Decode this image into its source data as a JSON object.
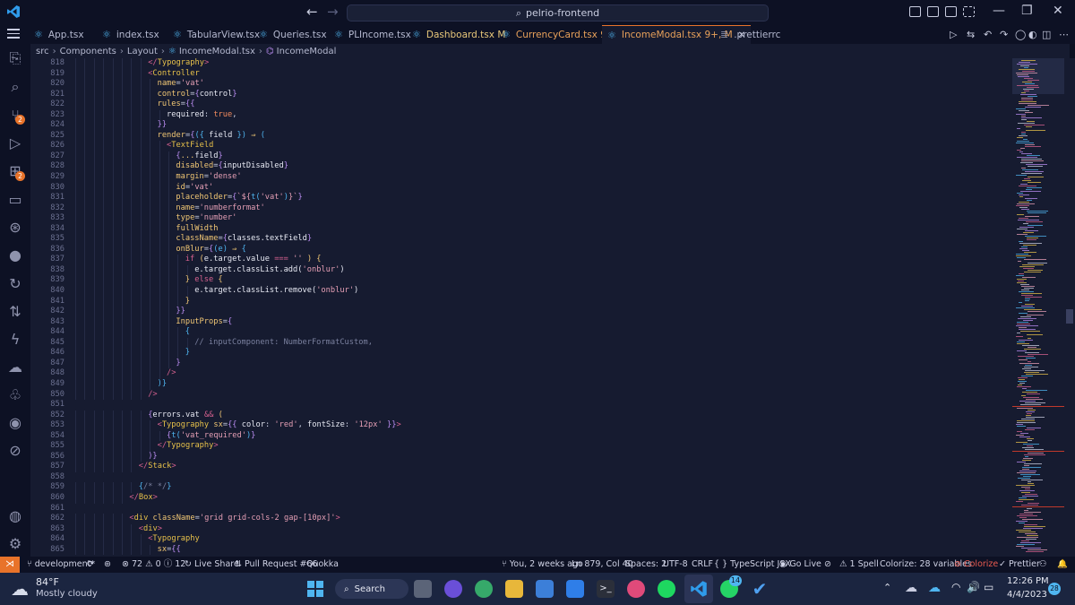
{
  "window": {
    "search_text": "pelrio-frontend"
  },
  "tabs": [
    {
      "label": "App.tsx",
      "color": "#b4b8cf"
    },
    {
      "label": "index.tsx",
      "color": "#b4b8cf"
    },
    {
      "label": "TabularView.tsx",
      "color": "#b4b8cf"
    },
    {
      "label": "Queries.tsx",
      "color": "#b4b8cf"
    },
    {
      "label": "PLIncome.tsx",
      "color": "#b4b8cf"
    },
    {
      "label": "Dashboard.tsx M",
      "color": "#e8c77a"
    },
    {
      "label": "CurrencyCard.tsx 9+",
      "color": "#e8a15a"
    },
    {
      "label": "IncomeModal.tsx 9+, M",
      "color": "#e8a15a"
    },
    {
      "label": ".prettierrc",
      "color": "#b4b8cf"
    }
  ],
  "breadcrumb": [
    "src",
    "Components",
    "Layout",
    "IncomeModal.tsx",
    "IncomeModal"
  ],
  "editor": {
    "lines": [
      {
        "n": "818",
        "i": 8,
        "t": [
          [
            "</",
            "#d6618f"
          ],
          [
            "Typography",
            "#e6c04a"
          ],
          [
            ">",
            "#d6618f"
          ]
        ]
      },
      {
        "n": "819",
        "i": 8,
        "t": [
          [
            "<",
            "#d6618f"
          ],
          [
            "Controller",
            "#e6c04a"
          ]
        ]
      },
      {
        "n": "820",
        "i": 9,
        "t": [
          [
            "name",
            "#f0c674"
          ],
          [
            "=",
            "#c9cde0"
          ],
          [
            "'vat'",
            "#e59fb5"
          ]
        ]
      },
      {
        "n": "821",
        "i": 9,
        "t": [
          [
            "control",
            "#f0c674"
          ],
          [
            "=",
            "#c9cde0"
          ],
          [
            "{",
            "#b98cf0"
          ],
          [
            "control",
            "#e6e8f2"
          ],
          [
            "}",
            "#b98cf0"
          ]
        ]
      },
      {
        "n": "822",
        "i": 9,
        "t": [
          [
            "rules",
            "#f0c674"
          ],
          [
            "=",
            "#c9cde0"
          ],
          [
            "{{",
            "#b98cf0"
          ]
        ]
      },
      {
        "n": "823",
        "i": 10,
        "t": [
          [
            "required",
            "#e6e8f2"
          ],
          [
            ": ",
            "#c9cde0"
          ],
          [
            "true",
            "#f08a5d"
          ],
          [
            ",",
            "#c9cde0"
          ]
        ]
      },
      {
        "n": "824",
        "i": 9,
        "t": [
          [
            "}}",
            "#b98cf0"
          ]
        ]
      },
      {
        "n": "825",
        "i": 9,
        "t": [
          [
            "render",
            "#f0c674"
          ],
          [
            "=",
            "#c9cde0"
          ],
          [
            "{",
            "#b98cf0"
          ],
          [
            "({ ",
            "#4fb5f0"
          ],
          [
            "field",
            "#e6e8f2"
          ],
          [
            " }) ",
            "#4fb5f0"
          ],
          [
            "⇒",
            "#f0c674"
          ],
          [
            " (",
            "#4fb5f0"
          ]
        ]
      },
      {
        "n": "826",
        "i": 10,
        "t": [
          [
            "<",
            "#d6618f"
          ],
          [
            "TextField",
            "#e6c04a"
          ]
        ]
      },
      {
        "n": "827",
        "i": 11,
        "t": [
          [
            "{",
            "#b98cf0"
          ],
          [
            "...",
            "#f0c674"
          ],
          [
            "field",
            "#e6e8f2"
          ],
          [
            "}",
            "#b98cf0"
          ]
        ]
      },
      {
        "n": "828",
        "i": 11,
        "t": [
          [
            "disabled",
            "#f0c674"
          ],
          [
            "=",
            "#c9cde0"
          ],
          [
            "{",
            "#b98cf0"
          ],
          [
            "inputDisabled",
            "#e6e8f2"
          ],
          [
            "}",
            "#b98cf0"
          ]
        ]
      },
      {
        "n": "829",
        "i": 11,
        "t": [
          [
            "margin",
            "#f0c674"
          ],
          [
            "=",
            "#c9cde0"
          ],
          [
            "'dense'",
            "#e59fb5"
          ]
        ]
      },
      {
        "n": "830",
        "i": 11,
        "t": [
          [
            "id",
            "#f0c674"
          ],
          [
            "=",
            "#c9cde0"
          ],
          [
            "'vat'",
            "#e59fb5"
          ]
        ]
      },
      {
        "n": "831",
        "i": 11,
        "t": [
          [
            "placeholder",
            "#f0c674"
          ],
          [
            "=",
            "#c9cde0"
          ],
          [
            "{",
            "#b98cf0"
          ],
          [
            "`${",
            "#e59fb5"
          ],
          [
            "t(",
            "#4fb5f0"
          ],
          [
            "'vat'",
            "#e59fb5"
          ],
          [
            ")",
            "#4fb5f0"
          ],
          [
            "}`",
            "#e59fb5"
          ],
          [
            "}",
            "#b98cf0"
          ]
        ]
      },
      {
        "n": "832",
        "i": 11,
        "t": [
          [
            "name",
            "#f0c674"
          ],
          [
            "=",
            "#c9cde0"
          ],
          [
            "'numberformat'",
            "#e59fb5"
          ]
        ]
      },
      {
        "n": "833",
        "i": 11,
        "t": [
          [
            "type",
            "#f0c674"
          ],
          [
            "=",
            "#c9cde0"
          ],
          [
            "'number'",
            "#e59fb5"
          ]
        ]
      },
      {
        "n": "834",
        "i": 11,
        "t": [
          [
            "fullWidth",
            "#f0c674"
          ]
        ]
      },
      {
        "n": "835",
        "i": 11,
        "t": [
          [
            "className",
            "#f0c674"
          ],
          [
            "=",
            "#c9cde0"
          ],
          [
            "{",
            "#b98cf0"
          ],
          [
            "classes",
            "#e6e8f2"
          ],
          [
            ".textField",
            "#e6e8f2"
          ],
          [
            "}",
            "#b98cf0"
          ]
        ]
      },
      {
        "n": "836",
        "i": 11,
        "t": [
          [
            "onBlur",
            "#f0c674"
          ],
          [
            "=",
            "#c9cde0"
          ],
          [
            "{",
            "#b98cf0"
          ],
          [
            "(e) ",
            "#4fb5f0"
          ],
          [
            "⇒",
            "#f0c674"
          ],
          [
            " {",
            "#4fb5f0"
          ]
        ]
      },
      {
        "n": "837",
        "i": 12,
        "t": [
          [
            "if ",
            "#d6618f"
          ],
          [
            "(",
            "#f0c674"
          ],
          [
            "e.target.value ",
            "#e6e8f2"
          ],
          [
            "===",
            "#d6618f"
          ],
          [
            " '' ",
            "#e59fb5"
          ],
          [
            ") {",
            "#f0c674"
          ]
        ]
      },
      {
        "n": "838",
        "i": 13,
        "t": [
          [
            "e.target.classList.add(",
            "#e6e8f2"
          ],
          [
            "'onblur'",
            "#e59fb5"
          ],
          [
            ")",
            "#e6e8f2"
          ]
        ]
      },
      {
        "n": "839",
        "i": 12,
        "t": [
          [
            "} ",
            "#f0c674"
          ],
          [
            "else",
            "#d6618f"
          ],
          [
            " {",
            "#f0c674"
          ]
        ]
      },
      {
        "n": "840",
        "i": 13,
        "t": [
          [
            "e.target.classList.remove(",
            "#e6e8f2"
          ],
          [
            "'onblur'",
            "#e59fb5"
          ],
          [
            ")",
            "#e6e8f2"
          ]
        ]
      },
      {
        "n": "841",
        "i": 12,
        "t": [
          [
            "}",
            "#f0c674"
          ]
        ]
      },
      {
        "n": "842",
        "i": 11,
        "t": [
          [
            "}}",
            "#b98cf0"
          ]
        ]
      },
      {
        "n": "843",
        "i": 11,
        "t": [
          [
            "InputProps",
            "#f0c674"
          ],
          [
            "=",
            "#c9cde0"
          ],
          [
            "{",
            "#b98cf0"
          ]
        ]
      },
      {
        "n": "844",
        "i": 12,
        "t": [
          [
            "{",
            "#4fb5f0"
          ]
        ]
      },
      {
        "n": "845",
        "i": 13,
        "t": [
          [
            "// inputComponent: NumberFormatCustom,",
            "#7a809e"
          ]
        ]
      },
      {
        "n": "846",
        "i": 12,
        "t": [
          [
            "}",
            "#4fb5f0"
          ]
        ]
      },
      {
        "n": "847",
        "i": 11,
        "t": [
          [
            "}",
            "#b98cf0"
          ]
        ]
      },
      {
        "n": "848",
        "i": 10,
        "t": [
          [
            "/>",
            "#d6618f"
          ]
        ]
      },
      {
        "n": "849",
        "i": 9,
        "t": [
          [
            ")}",
            "#4fb5f0"
          ]
        ]
      },
      {
        "n": "850",
        "i": 8,
        "t": [
          [
            "/>",
            "#d6618f"
          ]
        ]
      },
      {
        "n": "851",
        "i": 0,
        "t": []
      },
      {
        "n": "852",
        "i": 8,
        "t": [
          [
            "{",
            "#b98cf0"
          ],
          [
            "errors.vat ",
            "#e6e8f2"
          ],
          [
            "&&",
            "#d6618f"
          ],
          [
            " (",
            "#f0c674"
          ]
        ]
      },
      {
        "n": "853",
        "i": 9,
        "t": [
          [
            "<",
            "#d6618f"
          ],
          [
            "Typography ",
            "#e6c04a"
          ],
          [
            "sx",
            "#f0c674"
          ],
          [
            "=",
            "#c9cde0"
          ],
          [
            "{{ ",
            "#b98cf0"
          ],
          [
            "color",
            "#e6e8f2"
          ],
          [
            ": ",
            "#c9cde0"
          ],
          [
            "'red'",
            "#e59fb5"
          ],
          [
            ", ",
            "#c9cde0"
          ],
          [
            "fontSize",
            "#e6e8f2"
          ],
          [
            ": ",
            "#c9cde0"
          ],
          [
            "'12px'",
            "#e59fb5"
          ],
          [
            " }}",
            "#b98cf0"
          ],
          [
            ">",
            "#d6618f"
          ]
        ]
      },
      {
        "n": "854",
        "i": 10,
        "t": [
          [
            "{",
            "#b98cf0"
          ],
          [
            "t(",
            "#4fb5f0"
          ],
          [
            "'vat_required'",
            "#e59fb5"
          ],
          [
            ")",
            "#4fb5f0"
          ],
          [
            "}",
            "#b98cf0"
          ]
        ]
      },
      {
        "n": "855",
        "i": 9,
        "t": [
          [
            "</",
            "#d6618f"
          ],
          [
            "Typography",
            "#e6c04a"
          ],
          [
            ">",
            "#d6618f"
          ]
        ]
      },
      {
        "n": "856",
        "i": 8,
        "t": [
          [
            ")}",
            "#b98cf0"
          ]
        ]
      },
      {
        "n": "857",
        "i": 7,
        "t": [
          [
            "</",
            "#d6618f"
          ],
          [
            "Stack",
            "#e6c04a"
          ],
          [
            ">",
            "#d6618f"
          ]
        ]
      },
      {
        "n": "858",
        "i": 0,
        "t": []
      },
      {
        "n": "859",
        "i": 7,
        "t": [
          [
            "{",
            "#4fb5f0"
          ],
          [
            "/* */",
            "#7a809e"
          ],
          [
            "}",
            "#4fb5f0"
          ]
        ]
      },
      {
        "n": "860",
        "i": 6,
        "t": [
          [
            "</",
            "#d6618f"
          ],
          [
            "Box",
            "#e6c04a"
          ],
          [
            ">",
            "#d6618f"
          ]
        ]
      },
      {
        "n": "861",
        "i": 0,
        "t": []
      },
      {
        "n": "862",
        "i": 6,
        "t": [
          [
            "<",
            "#d6618f"
          ],
          [
            "div ",
            "#e6c04a"
          ],
          [
            "className",
            "#f0c674"
          ],
          [
            "=",
            "#c9cde0"
          ],
          [
            "'grid grid-cols-2 gap-[10px]'",
            "#e59fb5"
          ],
          [
            ">",
            "#d6618f"
          ]
        ]
      },
      {
        "n": "863",
        "i": 7,
        "t": [
          [
            "<",
            "#d6618f"
          ],
          [
            "div",
            "#e6c04a"
          ],
          [
            ">",
            "#d6618f"
          ]
        ]
      },
      {
        "n": "864",
        "i": 8,
        "t": [
          [
            "<",
            "#d6618f"
          ],
          [
            "Typography",
            "#e6c04a"
          ]
        ]
      },
      {
        "n": "865",
        "i": 9,
        "t": [
          [
            "sx",
            "#f0c674"
          ],
          [
            "=",
            "#c9cde0"
          ],
          [
            "{{",
            "#b98cf0"
          ]
        ]
      }
    ]
  },
  "statusbar": {
    "branch": "development*",
    "problems": "⊗ 72 ⚠ 0 ⓘ 12",
    "live_share": "Live Share",
    "pull_request": "Pull Request #66",
    "quokka": "Quokka",
    "blame": "You, 2 weeks ago",
    "cursor": "Ln 879, Col 40",
    "spaces": "Spaces: 2",
    "encoding": "UTF-8",
    "eol": "CRLF",
    "language": "TypeScript JSX",
    "go_live": "Go Live",
    "spell": "1 Spell",
    "colorize_vars": "Colorize: 28 variables",
    "colorize": "Colorize",
    "prettier": "Prettier"
  },
  "taskbar": {
    "temperature": "84°F",
    "weather": "Mostly cloudy",
    "search": "Search",
    "whatsapp_badge": "14",
    "time": "12:26 PM",
    "date": "4/4/2023",
    "notification_badge": "28"
  },
  "colors": {
    "accent": "#e8732a",
    "editor_bg": "#161b30",
    "chrome_bg": "#0d1124",
    "taskbar_bg": "#1b2540"
  }
}
